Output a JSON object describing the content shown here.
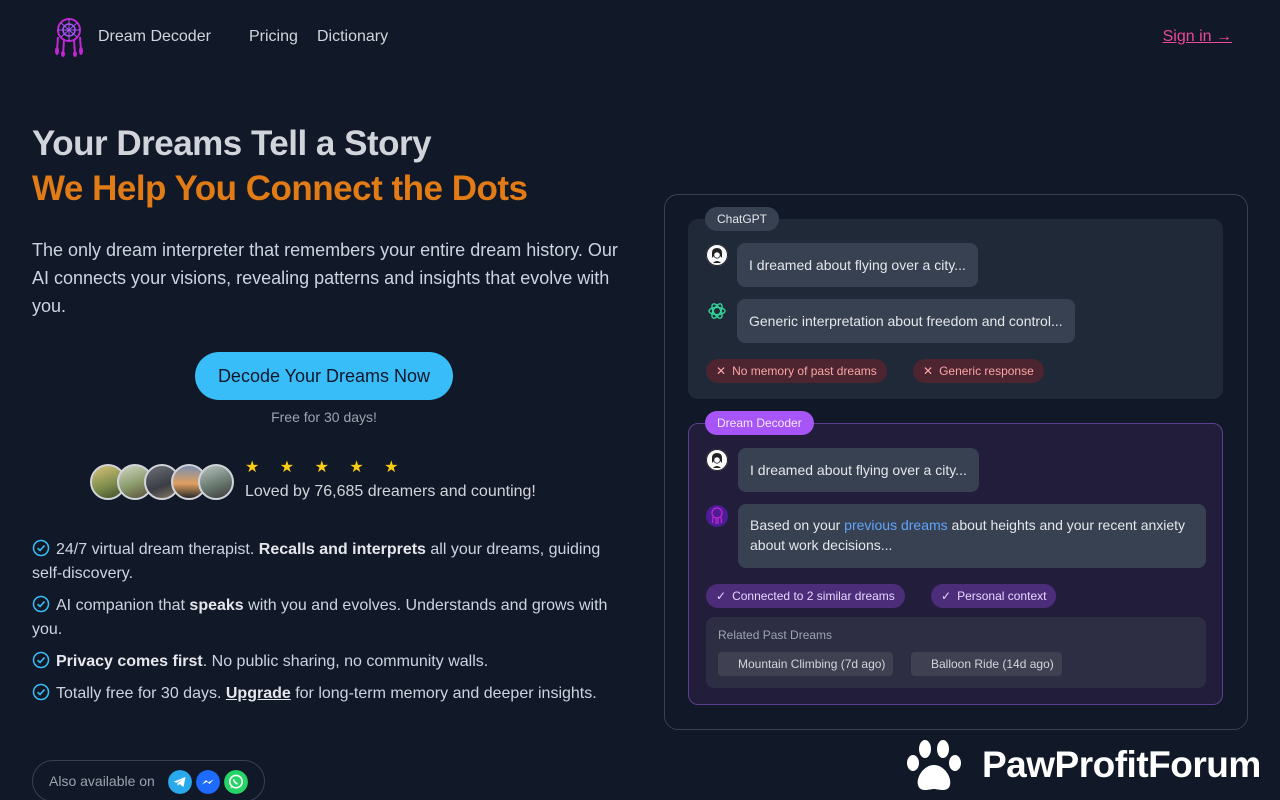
{
  "header": {
    "brand": "Dream Decoder",
    "nav": [
      "Pricing",
      "Dictionary"
    ],
    "sign_in": "Sign in →"
  },
  "hero": {
    "title_line1": "Your Dreams Tell a Story",
    "title_line2": "We Help You Connect the Dots",
    "description": "The only dream interpreter that remembers your entire dream history. Our AI connects your visions, revealing patterns and insights that evolve with you.",
    "cta": "Decode Your Dreams Now",
    "cta_note": "Free for 30 days!",
    "rating_stars": 5,
    "stars_text": "★ ★ ★ ★ ★",
    "social_proof": "Loved by 76,685 dreamers and counting!"
  },
  "features": [
    {
      "pre": "24/7 virtual dream therapist. ",
      "bold": "Recalls and interprets",
      "post": " all your dreams, guiding self-discovery."
    },
    {
      "pre": "AI companion that ",
      "bold": "speaks",
      "post": " with you and evolves. Understands and grows with you."
    },
    {
      "pre": "",
      "bold": "Privacy comes first",
      "post": ". No public sharing, no community walls."
    },
    {
      "pre": "Totally free for 30 days. ",
      "link": "Upgrade",
      "post": " for long-term memory and deeper insights."
    }
  ],
  "also_available": {
    "label": "Also available on",
    "apps": [
      "telegram-icon",
      "messenger-icon",
      "whatsapp-icon"
    ]
  },
  "comparison": {
    "chatgpt": {
      "tag": "ChatGPT",
      "user_msg": "I dreamed about flying over a city...",
      "ai_msg": "Generic interpretation about freedom and control...",
      "pills": [
        "No memory of past dreams",
        "Generic response"
      ]
    },
    "dream_decoder": {
      "tag": "Dream Decoder",
      "user_msg": "I dreamed about flying over a city...",
      "ai_msg_pre": "Based on your ",
      "ai_msg_link": "previous dreams",
      "ai_msg_post": " about heights and your recent anxiety about work decisions...",
      "pills": [
        "Connected to 2 similar dreams",
        "Personal context"
      ],
      "related_title": "Related Past Dreams",
      "related": [
        "Mountain Climbing (7d ago)",
        "Balloon Ride (14d ago)"
      ]
    }
  },
  "watermark": "PawProfitForum",
  "colors": {
    "background": "#111827",
    "accent_orange": "#e07b16",
    "cta_blue": "#38bdf8",
    "sign_in_pink": "#ec4899",
    "dream_purple": "#a855f7"
  }
}
